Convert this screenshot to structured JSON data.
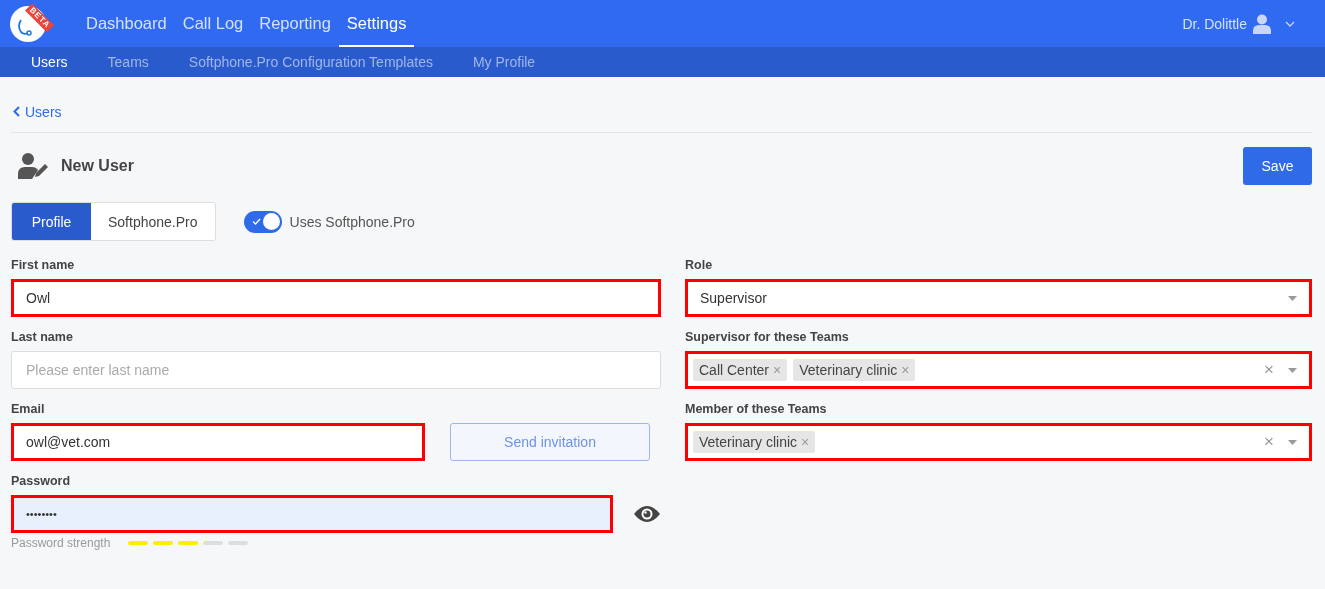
{
  "logo": {
    "badge": "BETA"
  },
  "nav": [
    {
      "label": "Dashboard",
      "selected": false
    },
    {
      "label": "Call Log",
      "selected": false
    },
    {
      "label": "Reporting",
      "selected": false
    },
    {
      "label": "Settings",
      "selected": true
    }
  ],
  "user_menu": {
    "name": "Dr. Dolittle"
  },
  "subnav": [
    {
      "label": "Users",
      "selected": true
    },
    {
      "label": "Teams",
      "selected": false
    },
    {
      "label": "Softphone.Pro Configuration Templates",
      "selected": false
    },
    {
      "label": "My Profile",
      "selected": false
    }
  ],
  "breadcrumb": "Users",
  "page_title": "New User",
  "save_button": "Save",
  "tabs": [
    {
      "label": "Profile",
      "selected": true
    },
    {
      "label": "Softphone.Pro",
      "selected": false
    }
  ],
  "toggle": {
    "label": "Uses Softphone.Pro",
    "on": true
  },
  "left_fields": [
    {
      "kind": "text",
      "label": "First name",
      "value": "Owl",
      "highlighted": true
    },
    {
      "kind": "text",
      "label": "Last name",
      "placeholder": "Please enter last name",
      "highlighted": false
    },
    {
      "kind": "email",
      "label": "Email",
      "value": "owl@vet.com",
      "highlighted": true,
      "button": "Send invitation"
    },
    {
      "kind": "password",
      "label": "Password",
      "value": "••••••••",
      "highlighted": true,
      "strength_label": "Password strength",
      "level": 0.6
    }
  ],
  "right_fields": [
    {
      "kind": "select",
      "label": "Role",
      "value": "Supervisor",
      "highlighted": true
    },
    {
      "kind": "tags",
      "label": "Supervisor for these Teams",
      "highlighted": true,
      "clear": "×",
      "tags": [
        {
          "label": "Call Center",
          "remove": "×"
        },
        {
          "label": "Veterinary clinic",
          "remove": "×"
        }
      ]
    },
    {
      "kind": "tags",
      "label": "Member of these Teams",
      "highlighted": true,
      "clear": "×",
      "tags": [
        {
          "label": "Veterinary clinic",
          "remove": "×"
        }
      ]
    }
  ]
}
